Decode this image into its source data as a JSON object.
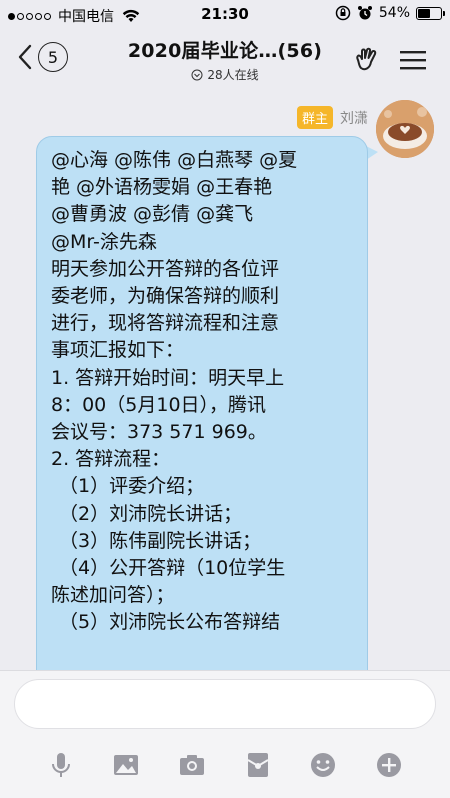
{
  "status_bar": {
    "carrier": "中国电信",
    "time": "21:30",
    "battery": "54%",
    "battery_level": 0.54,
    "signal_filled": 1,
    "signal_total": 5
  },
  "nav": {
    "back_badge": "5",
    "title": "2020届毕业论…(56)",
    "online": "28人在线"
  },
  "message": {
    "role_badge": "群主",
    "sender": "刘潇",
    "lines": [
      "@心海 @陈伟 @白燕琴 @夏",
      "艳 @外语杨雯娟 @王春艳",
      "@曹勇波 @彭倩 @龚飞",
      "@Mr-涂先森",
      "明天参加公开答辩的各位评",
      "委老师，为确保答辩的顺利",
      "进行，现将答辩流程和注意",
      "事项汇报如下：",
      "1. 答辩开始时间：明天早上",
      "8：00（5月10日），腾讯",
      "会议号：373 571 969。",
      "2. 答辩流程：",
      "（1）评委介绍；",
      "（2）刘沛院长讲话；",
      "（3）陈伟副院长讲话；",
      "（4）公开答辩（10位学生",
      "陈述加问答）；",
      "（5）刘沛院长公布答辩结"
    ],
    "indented": [
      12,
      13,
      14,
      15,
      17
    ]
  },
  "input": {
    "placeholder": ""
  },
  "toolbar": {
    "items": [
      "microphone-icon",
      "image-icon",
      "camera-icon",
      "red-packet-icon",
      "emoji-icon",
      "plus-icon"
    ]
  },
  "colors": {
    "bubble": "#bde0f5",
    "badge": "#f5b62a",
    "icon": "#9a9aa2"
  }
}
